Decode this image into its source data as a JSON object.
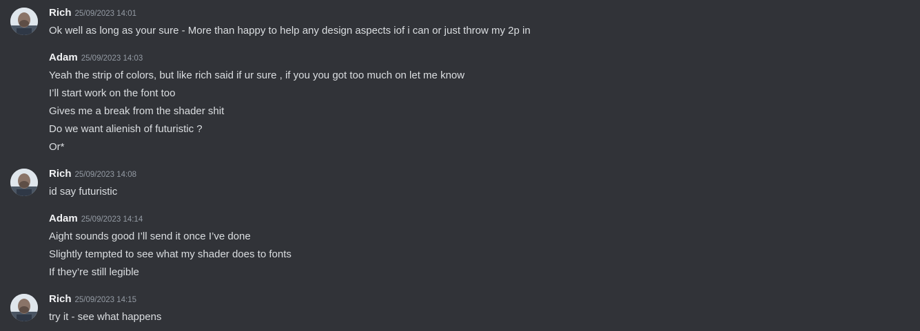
{
  "messages": [
    {
      "author": "Rich",
      "timestamp": "25/09/2023 14:01",
      "has_avatar": true,
      "lines": [
        "Ok well as long as your sure - More than happy to help any design aspects iof i can or just throw my 2p in"
      ]
    },
    {
      "author": "Adam",
      "timestamp": "25/09/2023 14:03",
      "has_avatar": false,
      "lines": [
        "Yeah the strip of colors, but like rich said if ur sure , if you you got too much on let me know",
        "I’ll start work on the font too",
        "Gives me a break from the shader shit",
        "Do we want alienish of futuristic ?",
        "Or*"
      ]
    },
    {
      "author": "Rich",
      "timestamp": "25/09/2023 14:08",
      "has_avatar": true,
      "lines": [
        "id say futuristic"
      ]
    },
    {
      "author": "Adam",
      "timestamp": "25/09/2023 14:14",
      "has_avatar": false,
      "lines": [
        "Aight sounds good I’ll send it once I’ve done",
        "Slightly tempted to see what my shader does to fonts",
        "If they’re still legible"
      ]
    },
    {
      "author": "Rich",
      "timestamp": "25/09/2023 14:15",
      "has_avatar": true,
      "lines": [
        "try it - see what happens"
      ]
    }
  ]
}
